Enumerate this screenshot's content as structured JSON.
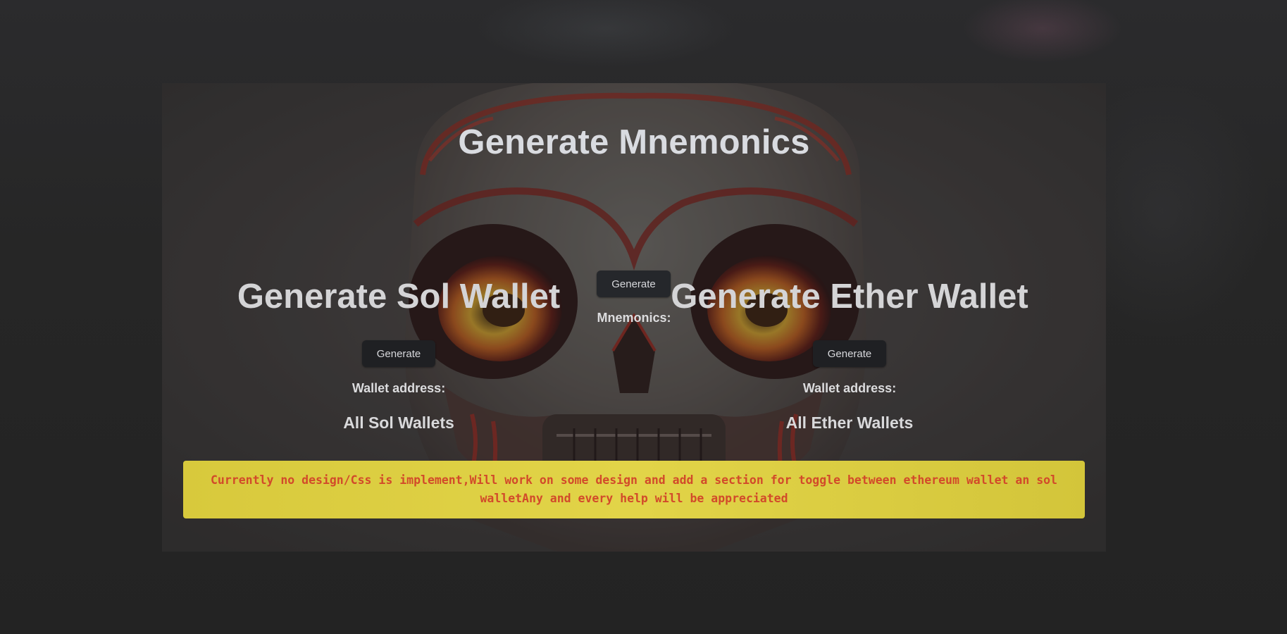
{
  "page": {
    "title": "Generate Mnemonics",
    "generate_button": "Generate",
    "mnemonics_label": "Mnemonics:"
  },
  "sol": {
    "title": "Generate Sol Wallet",
    "button": "Generate",
    "address_label": "Wallet address:",
    "all_wallets": "All Sol Wallets"
  },
  "ether": {
    "title": "Generate Ether Wallet",
    "button": "Generate",
    "address_label": "Wallet address:",
    "all_wallets": "All Ether Wallets"
  },
  "notice": {
    "text": "Currently no design/Css is implement,Will work on some design and add a section for toggle between ethereum wallet an sol walletAny and every help will be appreciated"
  },
  "colors": {
    "page_background": "#252525",
    "notice_background": "#e2d448",
    "notice_text": "#d24a2a",
    "button_background": "#1f2023",
    "heading_text": "#d9dbe0"
  },
  "background_image": {
    "icon": "skull-illustration"
  }
}
